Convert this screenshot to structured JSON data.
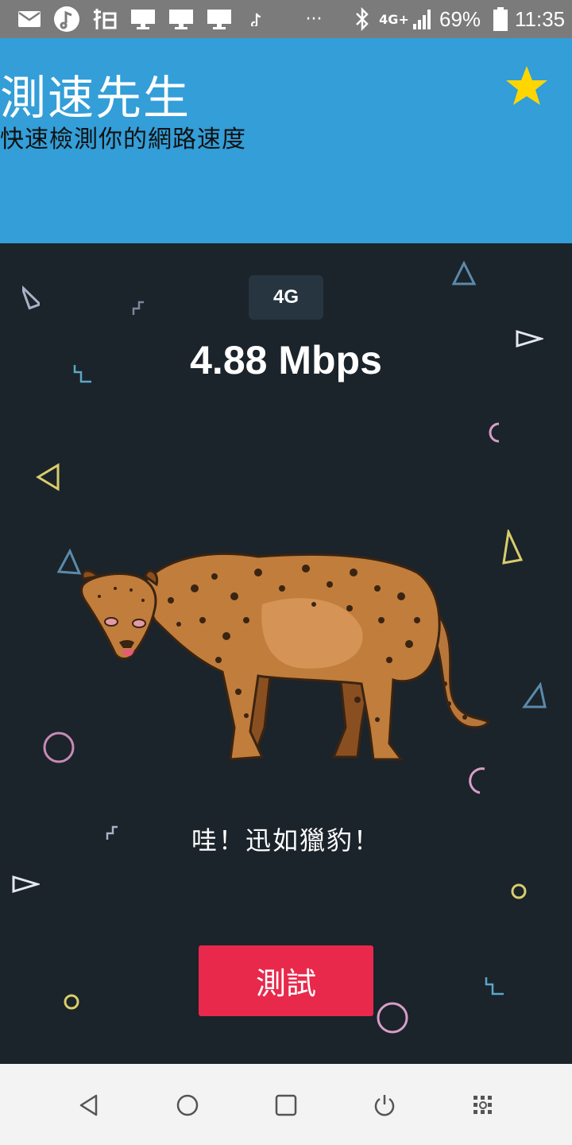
{
  "status_bar": {
    "battery_percent": "69%",
    "time": "11:35",
    "overflow": "···",
    "network": "4G+"
  },
  "header": {
    "title": "測速先生",
    "subtitle": "快速檢測你的網路速度"
  },
  "main": {
    "network_badge": "4G",
    "speed": "4.88 Mbps",
    "message": "哇！迅如獵豹！",
    "test_button": "測試"
  },
  "colors": {
    "header_bg": "#339ed8",
    "main_bg": "#1b232b",
    "button_bg": "#e8294b",
    "star": "#ffd600"
  },
  "icons": [
    "mail-icon",
    "music-app-icon",
    "app-icon",
    "monitor-icon",
    "tiktok-icon",
    "bluetooth-icon",
    "signal-icon",
    "battery-icon",
    "star-icon",
    "cheetah-illustration",
    "back-icon",
    "home-icon",
    "recents-icon",
    "power-icon",
    "screenshot-icon"
  ]
}
